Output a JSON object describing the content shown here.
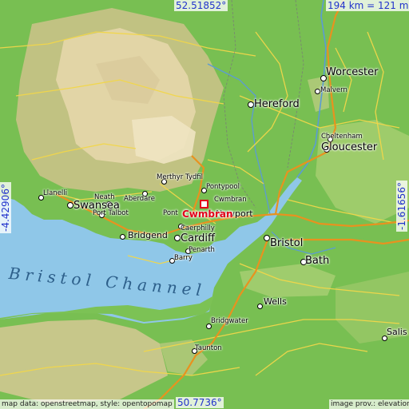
{
  "highlight": {
    "name": "Cwmbran",
    "color": "#e2001a"
  },
  "coords": {
    "top": "52.51852°",
    "bottom": "50.7736°",
    "left": "-4.42906°",
    "right": "-1.61656°",
    "scale": "194 km = 121 mi"
  },
  "sea_label": "Bristol Channel",
  "attribution": {
    "left": "map data: openstreetmap, style: opentopomap",
    "right": "image prov.: elevation.city"
  },
  "places": {
    "worcester": "Worcester",
    "malvern": "Malvern",
    "hereford": "Hereford",
    "cheltenham": "Cheltenham",
    "gloucester": "Gloucester",
    "pontypool": "Pontypool",
    "cwmbran": "Cwmbran",
    "newport": "Newport",
    "merthyr": "Merthyr Tydfil",
    "aberdare": "Aberdare",
    "neath": "Neath",
    "llanelli": "Llanelli",
    "swansea": "Swansea",
    "porttalbot": "Port Talbot",
    "pont": "Pont",
    "caerphilly": "Caerphilly",
    "bridgend": "Bridgend",
    "cardiff": "Cardiff",
    "penarth": "Penarth",
    "barry": "Barry",
    "bristol": "Bristol",
    "bath": "Bath",
    "wells": "Wells",
    "bridgwater": "Bridgwater",
    "taunton": "Taunton",
    "salisbury": "Salis"
  },
  "colors": {
    "sea": "#8fc7e8",
    "lowland": "#6cb84a",
    "upland": "#c9c48a",
    "highland": "#e2d4a6",
    "motorway": "#e8921f",
    "road": "#f2d74a"
  }
}
